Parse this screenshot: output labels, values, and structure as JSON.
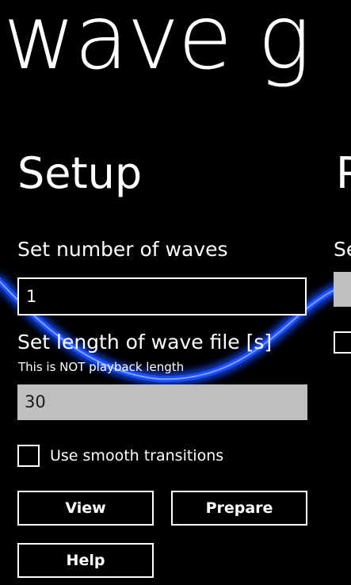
{
  "app": {
    "title": "wave g"
  },
  "pages": {
    "setup_header": "Setup",
    "next_header_partial": "P"
  },
  "setup": {
    "waves_label": "Set number of waves",
    "waves_value": "1",
    "length_label": "Set length of wave file [s]",
    "length_hint": "This is NOT playback length",
    "length_value": "30",
    "smooth_label": "Use smooth transitions",
    "smooth_checked": false
  },
  "next_page": {
    "label_partial": "Se"
  },
  "buttons": {
    "view": "View",
    "prepare": "Prepare",
    "help": "Help"
  },
  "colors": {
    "background": "#000000",
    "foreground": "#ffffff",
    "wave_glow": "#1a4dff",
    "disabled_field": "#bfbfbf"
  },
  "icons": {
    "wave_background": "wave-background-icon"
  }
}
